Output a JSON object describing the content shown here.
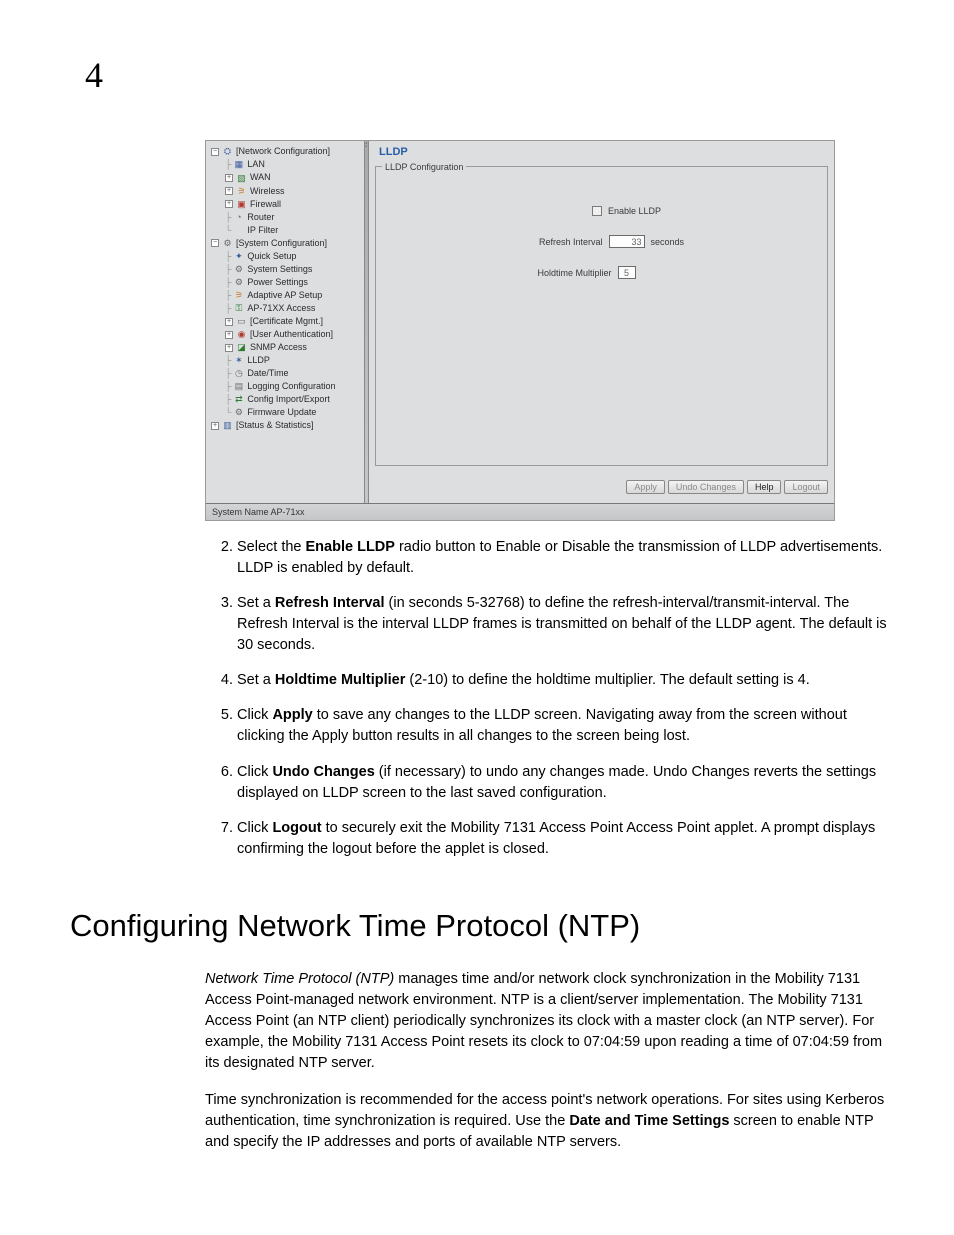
{
  "chapter": "4",
  "screenshot": {
    "nav": {
      "root1": {
        "label": "[Network Configuration]"
      },
      "lan": {
        "label": "LAN"
      },
      "wan": {
        "label": "WAN"
      },
      "wireless": {
        "label": "Wireless"
      },
      "firewall": {
        "label": "Firewall"
      },
      "router": {
        "label": "Router"
      },
      "ipfilter": {
        "label": "IP Filter"
      },
      "root2": {
        "label": "[System Configuration]"
      },
      "quicksetup": {
        "label": "Quick Setup"
      },
      "syssettings": {
        "label": "System Settings"
      },
      "powersettings": {
        "label": "Power Settings"
      },
      "adaptiveap": {
        "label": "Adaptive AP Setup"
      },
      "ap71xx": {
        "label": "AP-71XX Access"
      },
      "certmgmt": {
        "label": "[Certificate Mgmt.]"
      },
      "userauth": {
        "label": "[User Authentication]"
      },
      "snmp": {
        "label": "SNMP Access"
      },
      "lldp": {
        "label": "LLDP"
      },
      "datetime": {
        "label": "Date/Time"
      },
      "logcfg": {
        "label": "Logging Configuration"
      },
      "cfgimpexp": {
        "label": "Config Import/Export"
      },
      "fwupdate": {
        "label": "Firmware Update"
      },
      "root3": {
        "label": "[Status & Statistics]"
      }
    },
    "panel": {
      "title": "LLDP",
      "legend": "LLDP Configuration",
      "enable_label": "Enable LLDP",
      "refresh_label": "Refresh Interval",
      "refresh_value": "33",
      "refresh_unit": "seconds",
      "holdtime_label": "Holdtime Multiplier",
      "holdtime_value": "5"
    },
    "buttons": {
      "apply": "Apply",
      "undo": "Undo Changes",
      "help": "Help",
      "logout": "Logout"
    },
    "statusbar": "System Name AP-71xx"
  },
  "steps": {
    "s2a": "Select the ",
    "s2b": "Enable LLDP",
    "s2c": " radio button to Enable or Disable the transmission of LLDP advertisements. LLDP is enabled by default.",
    "s3a": "Set a ",
    "s3b": "Refresh Interval",
    "s3c": " (in seconds 5-32768) to define the refresh-interval/transmit-interval. The Refresh Interval is the interval LLDP frames is transmitted on behalf of the LLDP agent. The default is 30 seconds.",
    "s4a": "Set a ",
    "s4b": "Holdtime Multiplier",
    "s4c": " (2-10) to define the holdtime multiplier. The default setting is 4.",
    "s5a": "Click ",
    "s5b": "Apply",
    "s5c": " to save any changes to the LLDP screen. Navigating away from the screen without clicking the Apply button results in all changes to the screen being lost.",
    "s6a": "Click ",
    "s6b": "Undo Changes",
    "s6c": " (if necessary) to undo any changes made. Undo Changes reverts the settings displayed on LLDP screen to the last saved configuration.",
    "s7a": "Click ",
    "s7b": "Logout",
    "s7c": " to securely exit the Mobility 7131 Access Point Access Point applet. A prompt displays confirming the logout before the applet is closed."
  },
  "section_heading": "Configuring Network Time Protocol (NTP)",
  "para1a": "Network Time Protocol (NTP)",
  "para1b": " manages time and/or network clock synchronization in the Mobility 7131 Access Point-managed network environment. NTP is a client/server implementation. The Mobility 7131 Access Point (an NTP client) periodically synchronizes its clock with a master clock (an NTP server). For example, the Mobility 7131 Access Point resets its clock to 07:04:59 upon reading a time of 07:04:59 from its designated NTP server.",
  "para2a": "Time synchronization is recommended for the access point's network operations. For sites using Kerberos authentication, time synchronization is required. Use the ",
  "para2b": "Date and Time Settings",
  "para2c": " screen to enable NTP and specify the IP addresses and ports of available NTP servers."
}
